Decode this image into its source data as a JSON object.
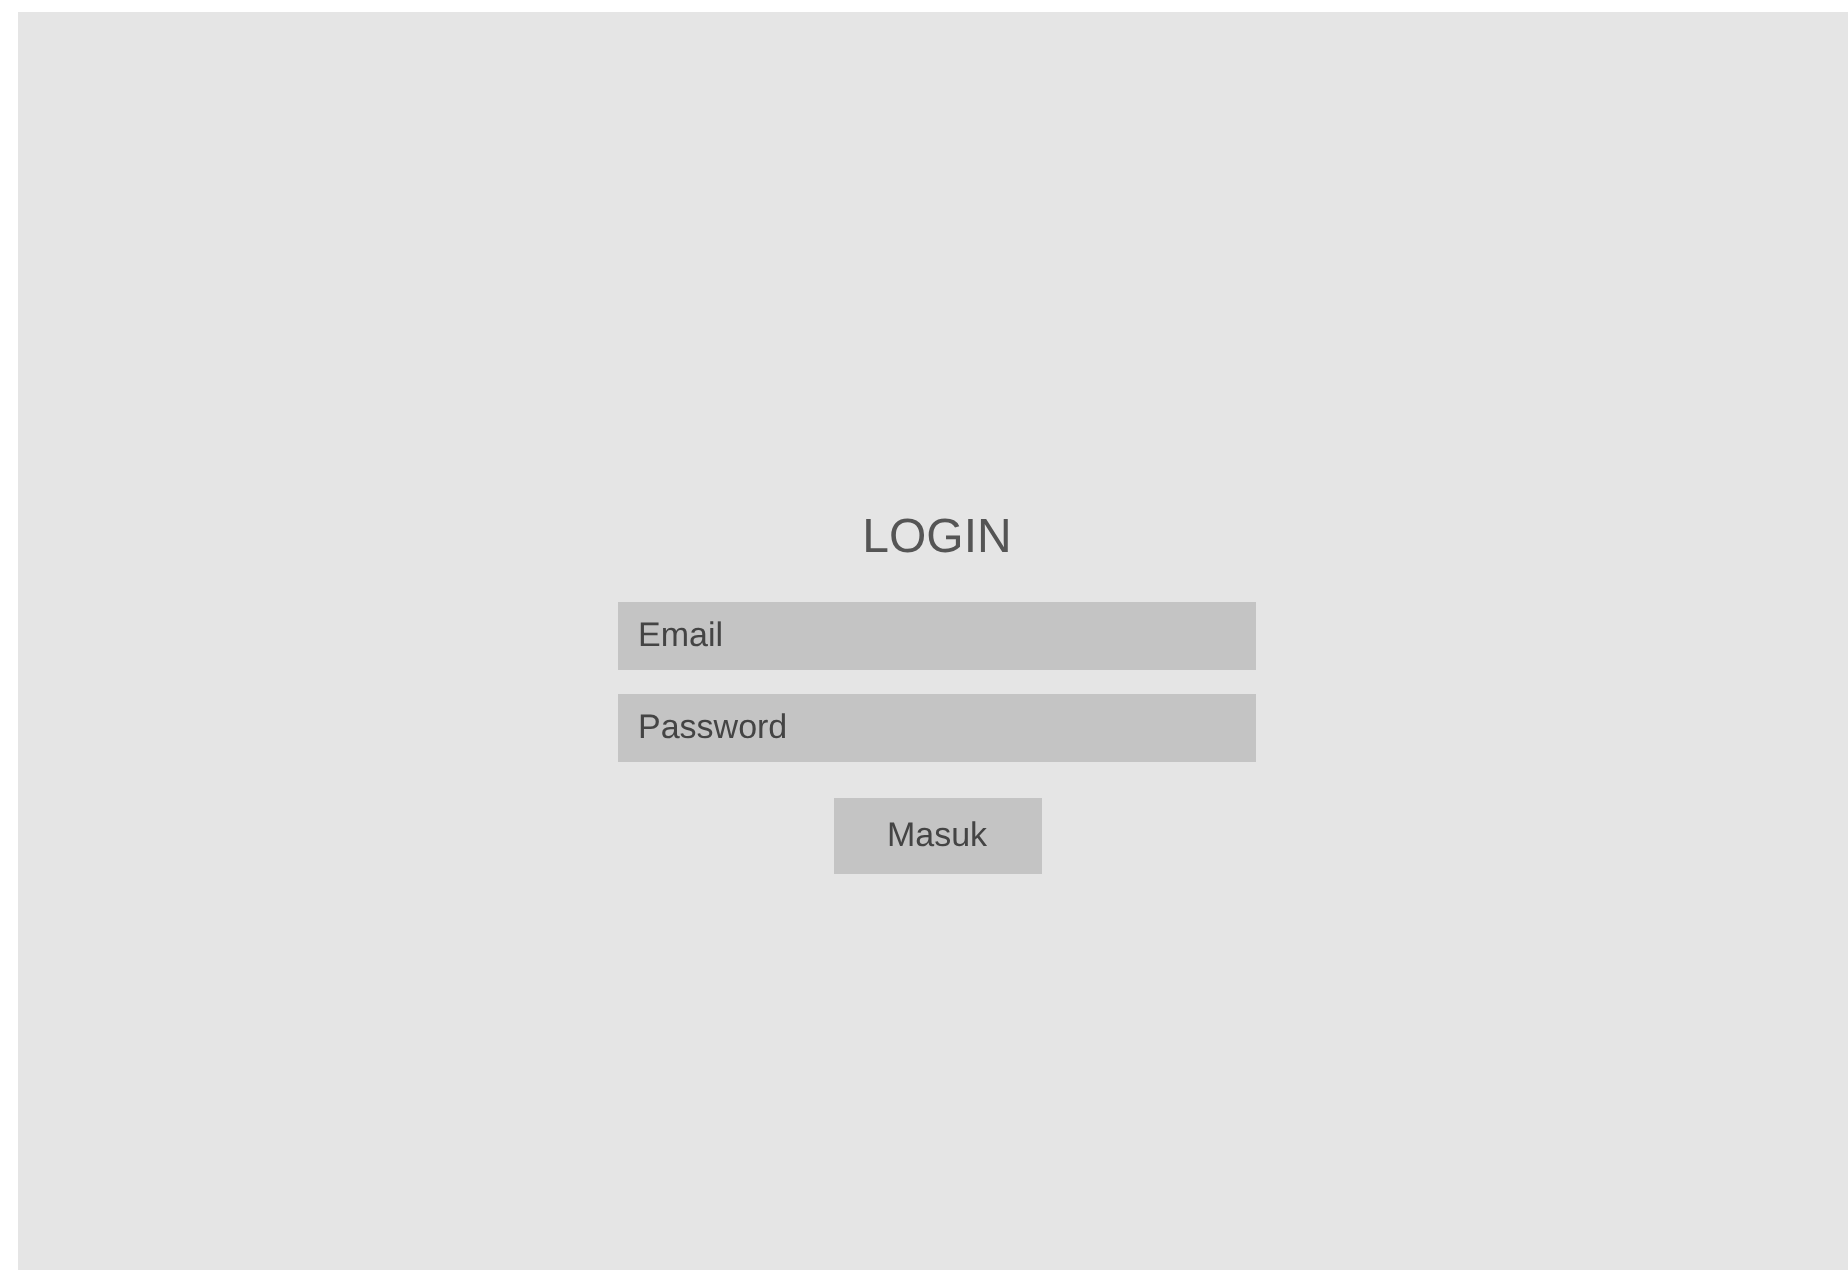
{
  "title": "LOGIN",
  "fields": [
    {
      "placeholder": "Email"
    },
    {
      "placeholder": "Password"
    }
  ],
  "submit_button": {
    "label": "Masuk"
  }
}
